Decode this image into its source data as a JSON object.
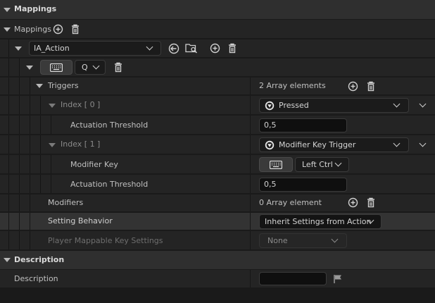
{
  "header": {
    "title": "Mappings"
  },
  "mappings": {
    "label": "Mappings"
  },
  "action": {
    "value": "IA_Action"
  },
  "key": {
    "value": "Q"
  },
  "triggers": {
    "label": "Triggers",
    "count": "2 Array elements",
    "items": [
      {
        "index_label": "Index [ 0 ]",
        "type": "Pressed",
        "props": [
          {
            "label": "Actuation Threshold",
            "value": "0,5"
          }
        ]
      },
      {
        "index_label": "Index [ 1 ]",
        "type": "Modifier Key Trigger",
        "props": [
          {
            "label": "Modifier Key",
            "value": "Left Ctrl"
          },
          {
            "label": "Actuation Threshold",
            "value": "0,5"
          }
        ]
      }
    ]
  },
  "modifiers": {
    "label": "Modifiers",
    "count": "0 Array element"
  },
  "setting_behavior": {
    "label": "Setting Behavior",
    "value": "Inherit Settings from Action"
  },
  "player_mappable": {
    "label": "Player Mappable Key Settings",
    "value": "None"
  },
  "description_section": {
    "title": "Description"
  },
  "description": {
    "label": "Description",
    "value": ""
  },
  "colors": {
    "background": "#1a1a1a",
    "section": "#2f2f2f",
    "row": "#242424",
    "input": "#0f0f0f"
  }
}
